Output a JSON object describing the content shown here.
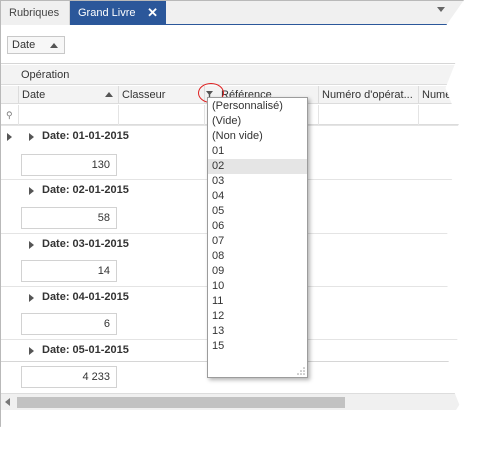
{
  "tabs": [
    {
      "label": "Rubriques",
      "active": false
    },
    {
      "label": "Grand Livre",
      "active": true
    }
  ],
  "group_panel": {
    "chip_label": "Date"
  },
  "band": {
    "label": "Opération"
  },
  "columns": {
    "date": "Date",
    "classeur": "Classeur",
    "reference": "Référence",
    "numero_operation": "Numéro d'opérat...",
    "numero2": "Numér"
  },
  "groups": [
    {
      "label": "Date: 01-01-2015",
      "sum": "130"
    },
    {
      "label": "Date: 02-01-2015",
      "sum": "58"
    },
    {
      "label": "Date: 03-01-2015",
      "sum": "14"
    },
    {
      "label": "Date: 04-01-2015",
      "sum": "6"
    },
    {
      "label": "Date: 05-01-2015",
      "sum": ""
    }
  ],
  "total": "4 233",
  "filter_popup": {
    "items": [
      "(Personnalisé)",
      "(Vide)",
      "(Non vide)",
      "01",
      "02",
      "03",
      "04",
      "05",
      "06",
      "07",
      "08",
      "09",
      "10",
      "11",
      "12",
      "13",
      "15"
    ],
    "selected": "02"
  },
  "colors": {
    "accent": "#2b579a",
    "highlight_circle": "#e02020"
  }
}
